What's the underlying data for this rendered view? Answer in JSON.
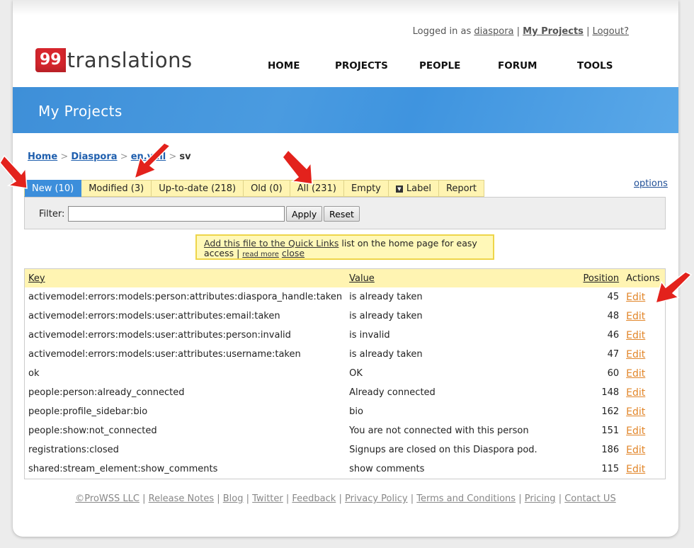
{
  "header": {
    "logged_in_prefix": "Logged in as",
    "username": "diaspora",
    "my_projects": "My Projects",
    "logout": "Logout?",
    "logo_badge": "99",
    "logo_word": "translations"
  },
  "nav": [
    "HOME",
    "PROJECTS",
    "PEOPLE",
    "FORUM",
    "TOOLS"
  ],
  "banner_title": "My Projects",
  "breadcrumb": [
    "Home",
    "Diaspora",
    "en.yml",
    "sv"
  ],
  "tabs": [
    "New (10)",
    "Modified (3)",
    "Up-to-date (218)",
    "Old (0)",
    "All (231)",
    "Empty",
    "Label",
    "Report"
  ],
  "options_link": "options",
  "filter": {
    "label": "Filter:",
    "value": "",
    "apply": "Apply",
    "reset": "Reset"
  },
  "notice": {
    "link": "Add this file to the Quick Links",
    "text": " list on the home page for easy access | ",
    "read_more": "read more",
    "close": "close"
  },
  "table": {
    "headers": {
      "key": "Key",
      "value": "Value",
      "position": "Position",
      "actions": "Actions"
    },
    "edit_label": "Edit",
    "rows": [
      {
        "key": "activemodel:errors:models:person:attributes:diaspora_handle:taken",
        "value": "is already taken",
        "position": "45"
      },
      {
        "key": "activemodel:errors:models:user:attributes:email:taken",
        "value": "is already taken",
        "position": "48"
      },
      {
        "key": "activemodel:errors:models:user:attributes:person:invalid",
        "value": "is invalid",
        "position": "46"
      },
      {
        "key": "activemodel:errors:models:user:attributes:username:taken",
        "value": "is already taken",
        "position": "47"
      },
      {
        "key": "ok",
        "value": "OK",
        "position": "60"
      },
      {
        "key": "people:person:already_connected",
        "value": "Already connected",
        "position": "148"
      },
      {
        "key": "people:profile_sidebar:bio",
        "value": "bio",
        "position": "162"
      },
      {
        "key": "people:show:not_connected",
        "value": "You are not connected with this person",
        "position": "151"
      },
      {
        "key": "registrations:closed",
        "value": "Signups are closed on this Diaspora pod.",
        "position": "186"
      },
      {
        "key": "shared:stream_element:show_comments",
        "value": "show comments",
        "position": "115"
      }
    ]
  },
  "footer": [
    "©ProWSS LLC",
    "Release Notes",
    "Blog",
    "Twitter",
    "Feedback",
    "Privacy Policy",
    "Terms and Conditions",
    "Pricing",
    "Contact US"
  ],
  "colors": {
    "banner": "#3e8fd8",
    "tab_bg": "#fff4b2",
    "tab_active": "#3c8edb",
    "edit": "#e2862a",
    "logo_red": "#d7262d",
    "arrow_red": "#e3221c"
  }
}
